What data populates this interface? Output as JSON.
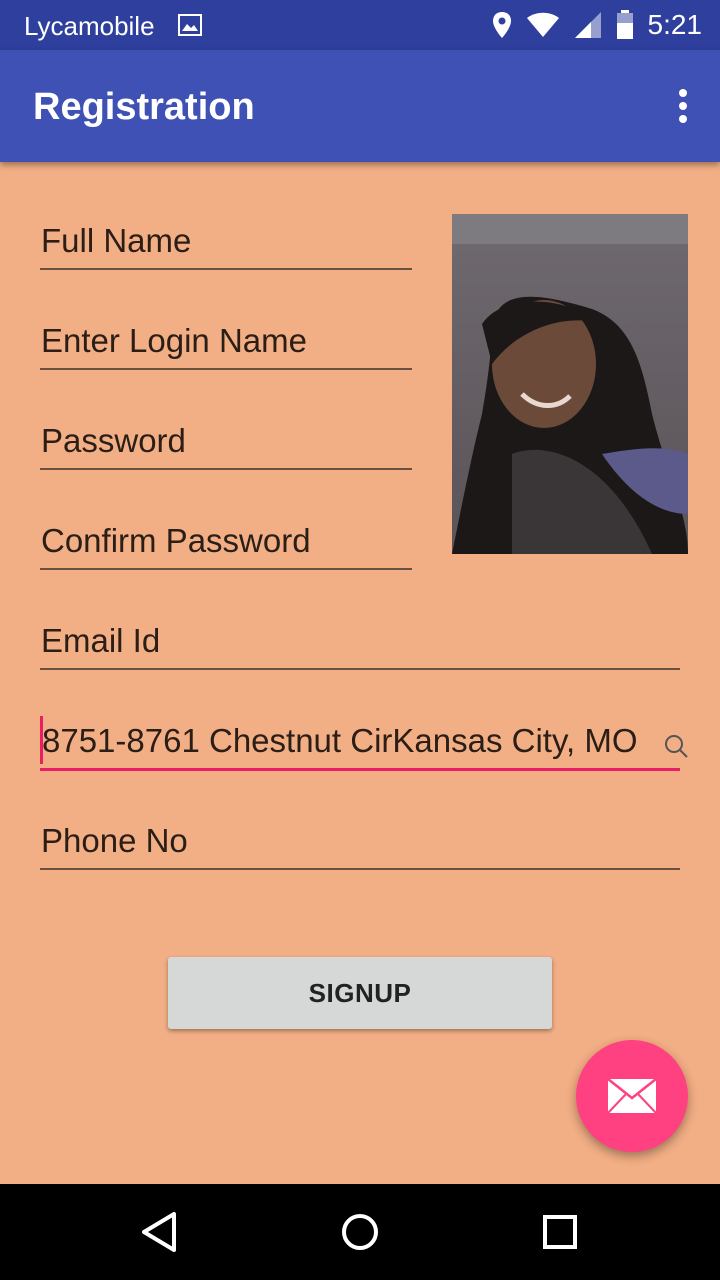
{
  "status_bar": {
    "carrier": "Lycamobile",
    "time": "5:21",
    "icons": [
      "image-icon",
      "location-icon",
      "wifi-icon",
      "signal-icon",
      "battery-icon"
    ]
  },
  "app_bar": {
    "title": "Registration",
    "menu_icon": "overflow-menu-icon"
  },
  "form": {
    "full_name": {
      "placeholder": "Full Name",
      "value": ""
    },
    "login_name": {
      "placeholder": "Enter Login Name",
      "value": ""
    },
    "password": {
      "placeholder": "Password",
      "value": ""
    },
    "confirm_password": {
      "placeholder": "Confirm Password",
      "value": ""
    },
    "email": {
      "placeholder": "Email Id",
      "value": ""
    },
    "address": {
      "placeholder": "",
      "value": "8751-8761 Chestnut CirKansas City, MO"
    },
    "phone": {
      "placeholder": "Phone No",
      "value": ""
    }
  },
  "profile_photo": {
    "alt": "profile photo"
  },
  "signup_button": {
    "label": "SIGNUP"
  },
  "fab": {
    "icon": "mail-icon"
  },
  "nav_bar": {
    "icons": [
      "back-icon",
      "home-icon",
      "recents-icon"
    ]
  },
  "colors": {
    "background": "#F2AE84",
    "app_bar": "#3F51B5",
    "status_bar": "#2F3F9E",
    "accent": "#FF4081",
    "underline_active": "#E91E63"
  }
}
